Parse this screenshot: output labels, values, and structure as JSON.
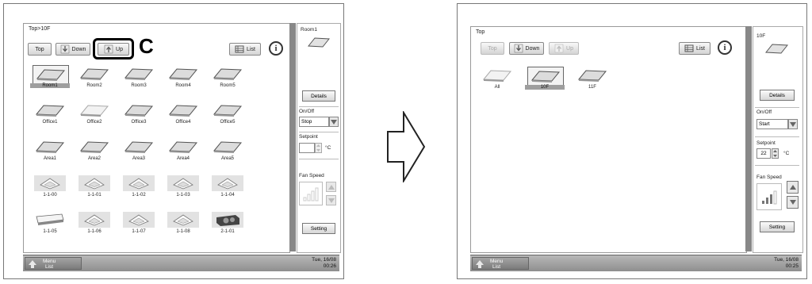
{
  "left": {
    "breadcrumb": "Top>10F",
    "nav": {
      "top": "Top",
      "down": "Down",
      "up": "Up",
      "list": "List"
    },
    "callout_letter": "C",
    "tiles": [
      {
        "label": "Room1",
        "kind": "flat",
        "selected": true
      },
      {
        "label": "Room2",
        "kind": "flat"
      },
      {
        "label": "Room3",
        "kind": "flat"
      },
      {
        "label": "Room4",
        "kind": "flat"
      },
      {
        "label": "Room5",
        "kind": "flat"
      },
      {
        "label": "Office1",
        "kind": "flat"
      },
      {
        "label": "Office2",
        "kind": "flat-light"
      },
      {
        "label": "Office3",
        "kind": "flat"
      },
      {
        "label": "Office4",
        "kind": "flat"
      },
      {
        "label": "Office5",
        "kind": "flat"
      },
      {
        "label": "Area1",
        "kind": "flat"
      },
      {
        "label": "Area2",
        "kind": "flat"
      },
      {
        "label": "Area3",
        "kind": "flat"
      },
      {
        "label": "Area4",
        "kind": "flat"
      },
      {
        "label": "Area5",
        "kind": "flat"
      },
      {
        "label": "1-1-00",
        "kind": "cassette"
      },
      {
        "label": "1-1-01",
        "kind": "cassette"
      },
      {
        "label": "1-1-02",
        "kind": "cassette"
      },
      {
        "label": "1-1-03",
        "kind": "cassette"
      },
      {
        "label": "1-1-04",
        "kind": "cassette"
      },
      {
        "label": "1-1-05",
        "kind": "wall"
      },
      {
        "label": "1-1-06",
        "kind": "cassette"
      },
      {
        "label": "1-1-07",
        "kind": "cassette"
      },
      {
        "label": "1-1-08",
        "kind": "cassette"
      },
      {
        "label": "2-1-01",
        "kind": "duct"
      }
    ],
    "panel": {
      "name": "Room1",
      "details": "Details",
      "onoff_label": "On/Off",
      "onoff_value": "Stop",
      "setpoint_label": "Setpoint",
      "setpoint_value": "",
      "unit": "°C",
      "fan_label": "Fan Speed",
      "setting": "Setting"
    },
    "footer": {
      "menu": "Menu List",
      "date": "Tue, 16/08",
      "time": "00:26"
    }
  },
  "right": {
    "breadcrumb": "Top",
    "nav": {
      "top": "Top",
      "down": "Down",
      "up": "Up",
      "list": "List"
    },
    "tiles": [
      {
        "label": "All",
        "kind": "flat-light"
      },
      {
        "label": "10F",
        "kind": "flat",
        "selected": true
      },
      {
        "label": "11F",
        "kind": "flat"
      }
    ],
    "panel": {
      "name": "10F",
      "details": "Details",
      "onoff_label": "On/Off",
      "onoff_value": "Start",
      "setpoint_label": "Setpoint",
      "setpoint_value": "22",
      "unit": "°C",
      "fan_label": "Fan Speed",
      "setting": "Setting"
    },
    "footer": {
      "menu": "Menu List",
      "date": "Tue, 16/08",
      "time": "00:25"
    }
  }
}
